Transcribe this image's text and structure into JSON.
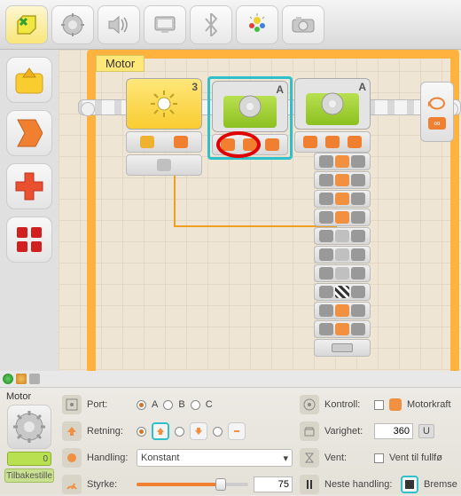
{
  "toolbar": {
    "items": [
      "start-program",
      "settings",
      "sound",
      "display",
      "bluetooth",
      "light",
      "camera"
    ]
  },
  "palette": {
    "items": [
      "arrow-up",
      "signal",
      "plus-red",
      "grid-red"
    ]
  },
  "canvas": {
    "motor_label": "Motor",
    "blocks": {
      "light": {
        "badge": "3"
      },
      "motor_a_sel": {
        "badge": "A"
      },
      "motor_a_big": {
        "badge": "A"
      }
    }
  },
  "indicators": [
    "green",
    "orange",
    "grey"
  ],
  "config": {
    "title": "Motor",
    "power_bar": "0",
    "reset_label": "Tilbakestille",
    "port": {
      "label": "Port:",
      "options": [
        "A",
        "B",
        "C"
      ],
      "selected": "A"
    },
    "direction": {
      "label": "Retning:",
      "selected": "up"
    },
    "action": {
      "label": "Handling:",
      "value": "Konstant"
    },
    "power": {
      "label": "Styrke:",
      "value": "75"
    },
    "control": {
      "label": "Kontroll:",
      "option": "Motorkraft"
    },
    "duration": {
      "label": "Varighet:",
      "value": "360",
      "unit": "U"
    },
    "wait": {
      "label": "Vent:",
      "option": "Vent til fullfø"
    },
    "brake_label": "Bremse"
  }
}
